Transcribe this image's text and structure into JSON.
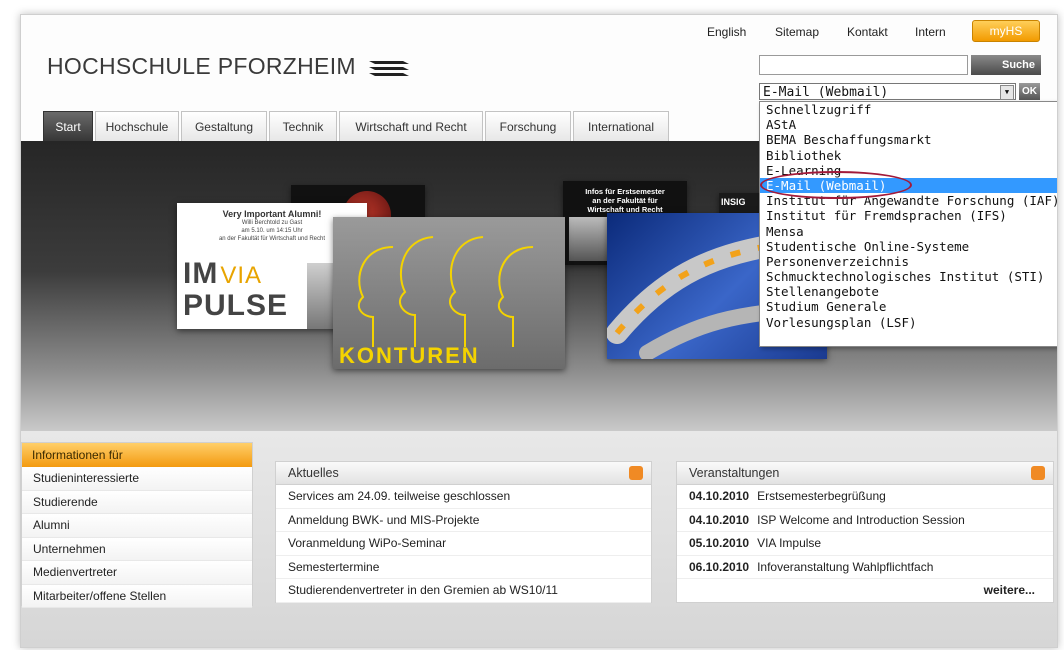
{
  "top_links": [
    "English",
    "Sitemap",
    "Kontakt",
    "Intern"
  ],
  "myhs_label": "myHS",
  "logo_text": "HOCHSCHULE PFORZHEIM",
  "search": {
    "button_label": "Suche",
    "value": ""
  },
  "select": {
    "selected": "E-Mail (Webmail)",
    "ok_label": "OK"
  },
  "tabs": [
    "Start",
    "Hochschule",
    "Gestaltung",
    "Technik",
    "Wirtschaft und Recht",
    "Forschung",
    "International"
  ],
  "hero_cards": {
    "alumni": {
      "title": "Very Important Alumni!",
      "line1": "Willi Berchtold zu Gast",
      "line2": "am 5.10. um 14:15 Uhr",
      "line3": "an der Fakultät für Wirtschaft und Recht",
      "impulse_line1": "IM",
      "impulse_via": "VIA",
      "impulse_line2": "PULSE"
    },
    "konturen": {
      "label": "KONTUREN"
    },
    "infos": {
      "line1": "Infos für Erstsemester",
      "line2": "an der Fakultät für",
      "line3": "Wirtschaft und Recht"
    },
    "insight": {
      "label": "INSIG"
    }
  },
  "dropdown_items": [
    "Schnellzugriff",
    "AStA",
    "BEMA Beschaffungsmarkt",
    "Bibliothek",
    "E-Learning",
    "E-Mail (Webmail)",
    "Institut für Angewandte Forschung (IAF)",
    "Institut für Fremdsprachen (IFS)",
    "Mensa",
    "Studentische Online-Systeme",
    "Personenverzeichnis",
    "Schmucktechnologisches Institut (STI)",
    "Stellenangebote",
    "Studium Generale",
    "Vorlesungsplan (LSF)"
  ],
  "dropdown_selected_index": 5,
  "info": {
    "header": "Informationen für",
    "items": [
      "Studieninteressierte",
      "Studierende",
      "Alumni",
      "Unternehmen",
      "Medienvertreter",
      "Mitarbeiter/offene Stellen"
    ]
  },
  "news": {
    "header": "Aktuelles",
    "items": [
      "Services am 24.09. teilweise geschlossen",
      "Anmeldung BWK- und MIS-Projekte",
      "Voranmeldung WiPo-Seminar",
      "Semestertermine",
      "Studierendenvertreter in den Gremien ab WS10/11"
    ]
  },
  "events": {
    "header": "Veranstaltungen",
    "items": [
      {
        "date": "04.10.2010",
        "title": "Erstsemesterbegrüßung"
      },
      {
        "date": "04.10.2010",
        "title": "ISP Welcome and Introduction Session"
      },
      {
        "date": "05.10.2010",
        "title": "VIA Impulse"
      },
      {
        "date": "06.10.2010",
        "title": "Infoveranstaltung Wahlpflichtfach"
      }
    ],
    "more_label": "weitere..."
  },
  "colors": {
    "accent_orange": "#f39a10",
    "selection_blue": "#3399ff",
    "annotation": "#a21a3a"
  }
}
